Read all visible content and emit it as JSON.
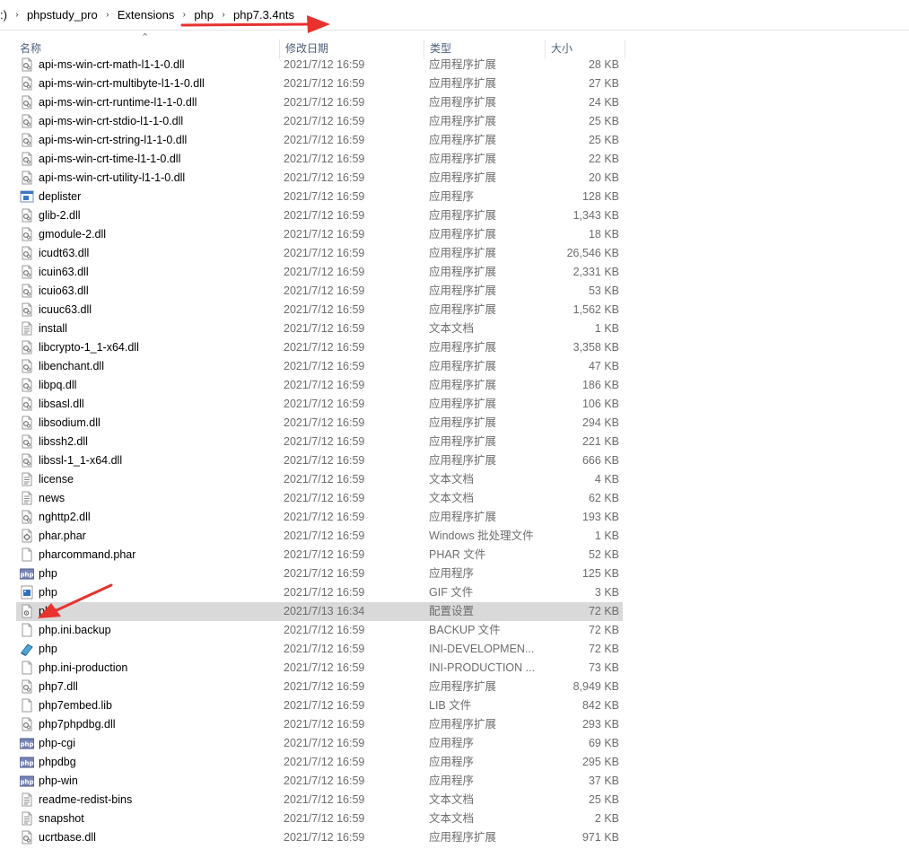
{
  "breadcrumb": {
    "items": [
      ":)",
      "phpstudy_pro",
      "Extensions",
      "php",
      "php7.3.4nts"
    ]
  },
  "columns": {
    "name": "名称",
    "date": "修改日期",
    "type": "类型",
    "size": "大小"
  },
  "files": [
    {
      "name": "api-ms-win-crt-math-l1-1-0.dll",
      "date": "2021/7/12 16:59",
      "type": "应用程序扩展",
      "size": "28 KB",
      "icon": "dll-icon"
    },
    {
      "name": "api-ms-win-crt-multibyte-l1-1-0.dll",
      "date": "2021/7/12 16:59",
      "type": "应用程序扩展",
      "size": "27 KB",
      "icon": "dll-icon"
    },
    {
      "name": "api-ms-win-crt-runtime-l1-1-0.dll",
      "date": "2021/7/12 16:59",
      "type": "应用程序扩展",
      "size": "24 KB",
      "icon": "dll-icon"
    },
    {
      "name": "api-ms-win-crt-stdio-l1-1-0.dll",
      "date": "2021/7/12 16:59",
      "type": "应用程序扩展",
      "size": "25 KB",
      "icon": "dll-icon"
    },
    {
      "name": "api-ms-win-crt-string-l1-1-0.dll",
      "date": "2021/7/12 16:59",
      "type": "应用程序扩展",
      "size": "25 KB",
      "icon": "dll-icon"
    },
    {
      "name": "api-ms-win-crt-time-l1-1-0.dll",
      "date": "2021/7/12 16:59",
      "type": "应用程序扩展",
      "size": "22 KB",
      "icon": "dll-icon"
    },
    {
      "name": "api-ms-win-crt-utility-l1-1-0.dll",
      "date": "2021/7/12 16:59",
      "type": "应用程序扩展",
      "size": "20 KB",
      "icon": "dll-icon"
    },
    {
      "name": "deplister",
      "date": "2021/7/12 16:59",
      "type": "应用程序",
      "size": "128 KB",
      "icon": "exe-icon"
    },
    {
      "name": "glib-2.dll",
      "date": "2021/7/12 16:59",
      "type": "应用程序扩展",
      "size": "1,343 KB",
      "icon": "dll-icon"
    },
    {
      "name": "gmodule-2.dll",
      "date": "2021/7/12 16:59",
      "type": "应用程序扩展",
      "size": "18 KB",
      "icon": "dll-icon"
    },
    {
      "name": "icudt63.dll",
      "date": "2021/7/12 16:59",
      "type": "应用程序扩展",
      "size": "26,546 KB",
      "icon": "dll-icon"
    },
    {
      "name": "icuin63.dll",
      "date": "2021/7/12 16:59",
      "type": "应用程序扩展",
      "size": "2,331 KB",
      "icon": "dll-icon"
    },
    {
      "name": "icuio63.dll",
      "date": "2021/7/12 16:59",
      "type": "应用程序扩展",
      "size": "53 KB",
      "icon": "dll-icon"
    },
    {
      "name": "icuuc63.dll",
      "date": "2021/7/12 16:59",
      "type": "应用程序扩展",
      "size": "1,562 KB",
      "icon": "dll-icon"
    },
    {
      "name": "install",
      "date": "2021/7/12 16:59",
      "type": "文本文档",
      "size": "1 KB",
      "icon": "text-file-icon"
    },
    {
      "name": "libcrypto-1_1-x64.dll",
      "date": "2021/7/12 16:59",
      "type": "应用程序扩展",
      "size": "3,358 KB",
      "icon": "dll-icon"
    },
    {
      "name": "libenchant.dll",
      "date": "2021/7/12 16:59",
      "type": "应用程序扩展",
      "size": "47 KB",
      "icon": "dll-icon"
    },
    {
      "name": "libpq.dll",
      "date": "2021/7/12 16:59",
      "type": "应用程序扩展",
      "size": "186 KB",
      "icon": "dll-icon"
    },
    {
      "name": "libsasl.dll",
      "date": "2021/7/12 16:59",
      "type": "应用程序扩展",
      "size": "106 KB",
      "icon": "dll-icon"
    },
    {
      "name": "libsodium.dll",
      "date": "2021/7/12 16:59",
      "type": "应用程序扩展",
      "size": "294 KB",
      "icon": "dll-icon"
    },
    {
      "name": "libssh2.dll",
      "date": "2021/7/12 16:59",
      "type": "应用程序扩展",
      "size": "221 KB",
      "icon": "dll-icon"
    },
    {
      "name": "libssl-1_1-x64.dll",
      "date": "2021/7/12 16:59",
      "type": "应用程序扩展",
      "size": "666 KB",
      "icon": "dll-icon"
    },
    {
      "name": "license",
      "date": "2021/7/12 16:59",
      "type": "文本文档",
      "size": "4 KB",
      "icon": "text-file-icon"
    },
    {
      "name": "news",
      "date": "2021/7/12 16:59",
      "type": "文本文档",
      "size": "62 KB",
      "icon": "text-file-icon"
    },
    {
      "name": "nghttp2.dll",
      "date": "2021/7/12 16:59",
      "type": "应用程序扩展",
      "size": "193 KB",
      "icon": "dll-icon"
    },
    {
      "name": "phar.phar",
      "date": "2021/7/12 16:59",
      "type": "Windows 批处理文件",
      "size": "1 KB",
      "icon": "batch-file-icon"
    },
    {
      "name": "pharcommand.phar",
      "date": "2021/7/12 16:59",
      "type": "PHAR 文件",
      "size": "52 KB",
      "icon": "blank-file-icon"
    },
    {
      "name": "php",
      "date": "2021/7/12 16:59",
      "type": "应用程序",
      "size": "125 KB",
      "icon": "php-exe-icon"
    },
    {
      "name": "php",
      "date": "2021/7/12 16:59",
      "type": "GIF 文件",
      "size": "3 KB",
      "icon": "gif-file-icon"
    },
    {
      "name": "php",
      "date": "2021/7/13 16:34",
      "type": "配置设置",
      "size": "72 KB",
      "icon": "config-file-icon",
      "selected": true
    },
    {
      "name": "php.ini.backup",
      "date": "2021/7/12 16:59",
      "type": "BACKUP 文件",
      "size": "72 KB",
      "icon": "blank-file-icon"
    },
    {
      "name": "php",
      "date": "2021/7/12 16:59",
      "type": "INI-DEVELOPMEN...",
      "size": "72 KB",
      "icon": "ini-dev-icon"
    },
    {
      "name": "php.ini-production",
      "date": "2021/7/12 16:59",
      "type": "INI-PRODUCTION ...",
      "size": "73 KB",
      "icon": "blank-file-icon"
    },
    {
      "name": "php7.dll",
      "date": "2021/7/12 16:59",
      "type": "应用程序扩展",
      "size": "8,949 KB",
      "icon": "dll-icon"
    },
    {
      "name": "php7embed.lib",
      "date": "2021/7/12 16:59",
      "type": "LIB 文件",
      "size": "842 KB",
      "icon": "blank-file-icon"
    },
    {
      "name": "php7phpdbg.dll",
      "date": "2021/7/12 16:59",
      "type": "应用程序扩展",
      "size": "293 KB",
      "icon": "dll-icon"
    },
    {
      "name": "php-cgi",
      "date": "2021/7/12 16:59",
      "type": "应用程序",
      "size": "69 KB",
      "icon": "php-exe-icon"
    },
    {
      "name": "phpdbg",
      "date": "2021/7/12 16:59",
      "type": "应用程序",
      "size": "295 KB",
      "icon": "php-exe-icon"
    },
    {
      "name": "php-win",
      "date": "2021/7/12 16:59",
      "type": "应用程序",
      "size": "37 KB",
      "icon": "php-exe-icon"
    },
    {
      "name": "readme-redist-bins",
      "date": "2021/7/12 16:59",
      "type": "文本文档",
      "size": "25 KB",
      "icon": "text-file-icon"
    },
    {
      "name": "snapshot",
      "date": "2021/7/12 16:59",
      "type": "文本文档",
      "size": "2 KB",
      "icon": "text-file-icon"
    },
    {
      "name": "ucrtbase.dll",
      "date": "2021/7/12 16:59",
      "type": "应用程序扩展",
      "size": "971 KB",
      "icon": "dll-icon"
    }
  ],
  "colors": {
    "selection": "#d9d9d9",
    "annotation_arrow": "#e8322e",
    "header_text": "#4c607a",
    "secondary_text": "#6d6d6d"
  }
}
